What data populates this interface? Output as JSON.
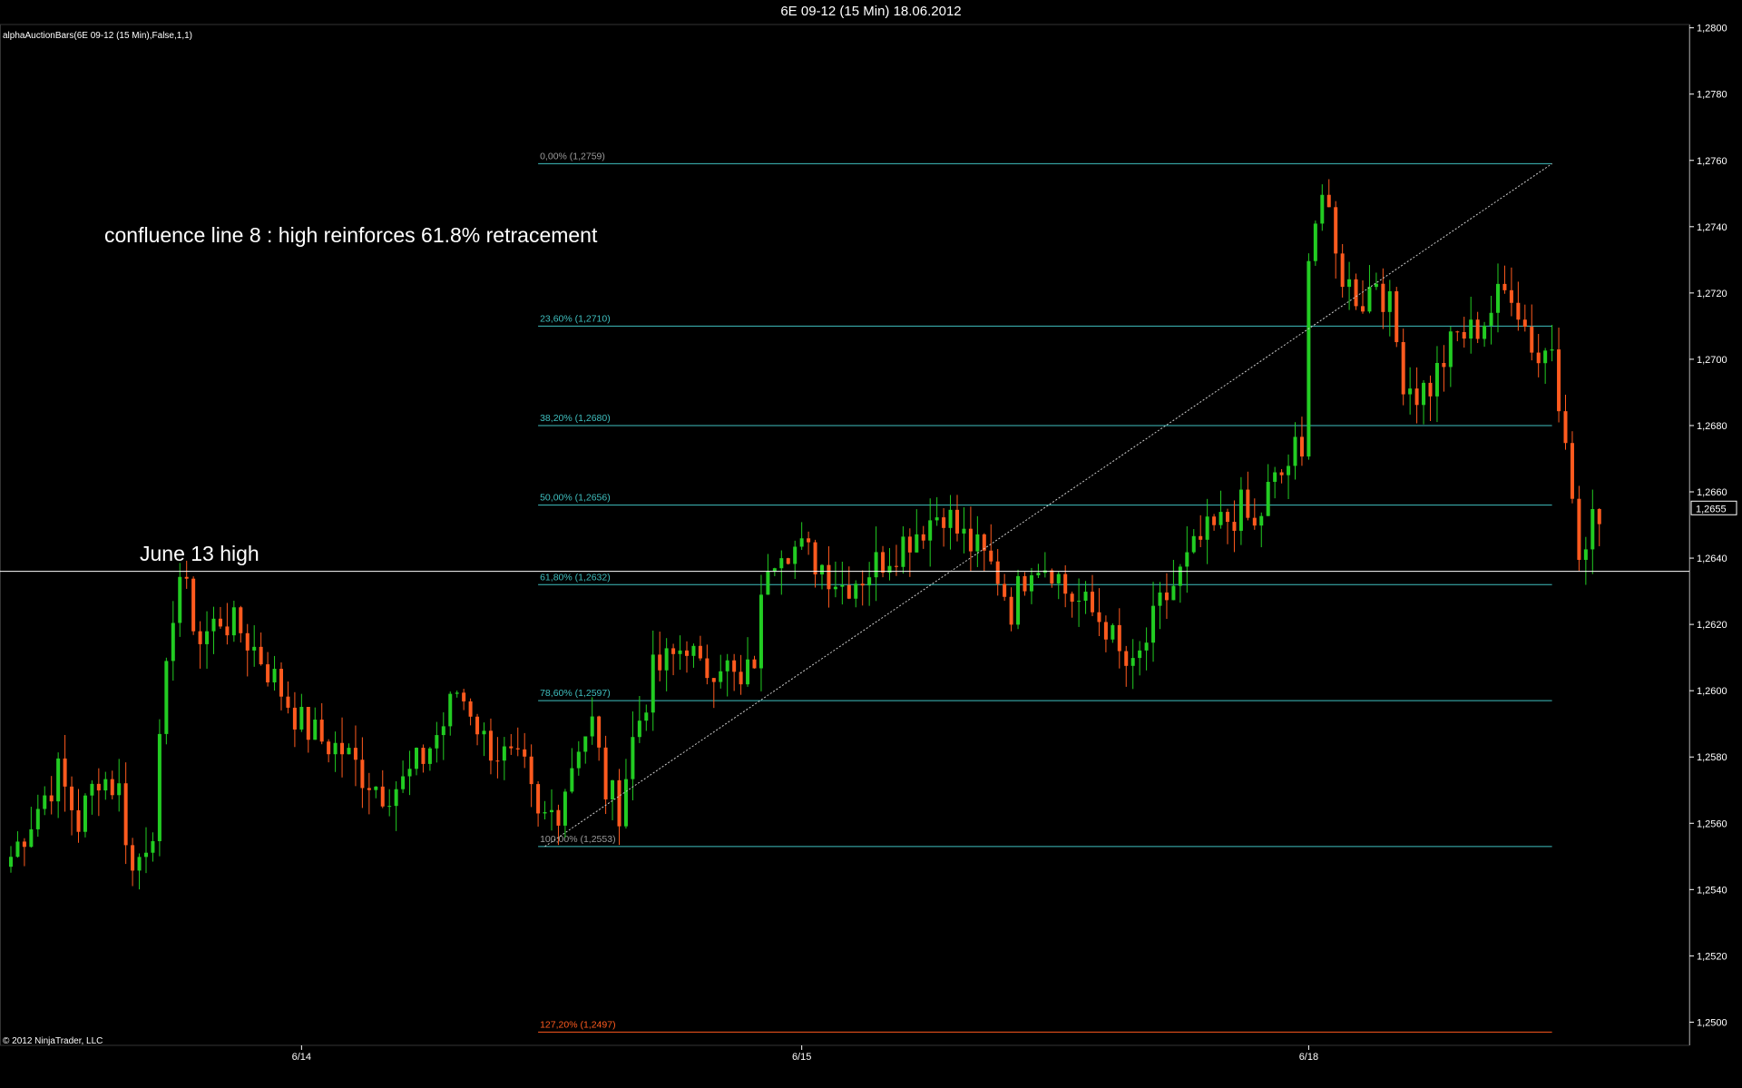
{
  "window": {
    "title": "6E 09-12 (15 Min)  18.06.2012",
    "indicator_label": "alphaAuctionBars(6E 09-12 (15 Min),False,1,1)",
    "copyright": "© 2012 NinjaTrader, LLC"
  },
  "annotations": {
    "confluence_text": "confluence line 8 : high reinforces 61.8% retracement",
    "june13_text": "June 13 high"
  },
  "colors": {
    "background": "#000000",
    "up_candle": "#22cc22",
    "down_candle": "#ff5a1e",
    "fib_line": "#3fbfbf",
    "fib_extension": "#ff5a1e",
    "axis": "#ffffff"
  },
  "chart_data": {
    "type": "candlestick",
    "instrument": "6E 09-12",
    "timeframe": "15 Min",
    "ylim": [
      1.2493,
      1.2801
    ],
    "y_ticks": [
      "1,2500",
      "1,2520",
      "1,2540",
      "1,2560",
      "1,2580",
      "1,2600",
      "1,2620",
      "1,2640",
      "1,2660",
      "1,2680",
      "1,2700",
      "1,2720",
      "1,2740",
      "1,2760",
      "1,2780",
      "1,2800"
    ],
    "x_ticks": [
      {
        "label": "6/14",
        "bar": 43
      },
      {
        "label": "6/15",
        "bar": 117
      },
      {
        "label": "6/18",
        "bar": 192
      }
    ],
    "current_price": "1,2655",
    "june13_high": 1.2636,
    "fibonacci": {
      "start_bar": 78,
      "end_bar": 228,
      "levels": [
        {
          "label": "0,00% (1,2759)",
          "price": 1.2759,
          "color": "grey"
        },
        {
          "label": "23,60% (1,2710)",
          "price": 1.271,
          "color": "cyan"
        },
        {
          "label": "38,20% (1,2680)",
          "price": 1.268,
          "color": "cyan"
        },
        {
          "label": "50,00% (1,2656)",
          "price": 1.2656,
          "color": "cyan"
        },
        {
          "label": "61,80% (1,2632)",
          "price": 1.2632,
          "color": "cyan"
        },
        {
          "label": "78,60% (1,2597)",
          "price": 1.2597,
          "color": "cyan"
        },
        {
          "label": "100,00% (1,2553)",
          "price": 1.2553,
          "color": "grey"
        },
        {
          "label": "127,20% (1,2497)",
          "price": 1.2497,
          "color": "orange"
        }
      ],
      "trendline": {
        "from": [
          79,
          1.2553
        ],
        "to": [
          228,
          1.2759
        ]
      }
    },
    "close_path": [
      [
        0,
        1.255
      ],
      [
        4,
        1.2565
      ],
      [
        7,
        1.2575
      ],
      [
        10,
        1.256
      ],
      [
        13,
        1.2575
      ],
      [
        16,
        1.257
      ],
      [
        18,
        1.2545
      ],
      [
        21,
        1.256
      ],
      [
        24,
        1.2625
      ],
      [
        25,
        1.2635
      ],
      [
        28,
        1.2615
      ],
      [
        31,
        1.2622
      ],
      [
        34,
        1.2618
      ],
      [
        37,
        1.261
      ],
      [
        40,
        1.26
      ],
      [
        43,
        1.259
      ],
      [
        46,
        1.2585
      ],
      [
        49,
        1.2582
      ],
      [
        52,
        1.2575
      ],
      [
        55,
        1.257
      ],
      [
        58,
        1.2572
      ],
      [
        61,
        1.258
      ],
      [
        64,
        1.259
      ],
      [
        66,
        1.26
      ],
      [
        68,
        1.2595
      ],
      [
        70,
        1.2585
      ],
      [
        73,
        1.258
      ],
      [
        76,
        1.2575
      ],
      [
        78,
        1.256
      ],
      [
        81,
        1.2565
      ],
      [
        84,
        1.2585
      ],
      [
        86,
        1.259
      ],
      [
        88,
        1.257
      ],
      [
        90,
        1.2565
      ],
      [
        92,
        1.2585
      ],
      [
        95,
        1.2605
      ],
      [
        98,
        1.261
      ],
      [
        100,
        1.2615
      ],
      [
        102,
        1.2605
      ],
      [
        105,
        1.261
      ],
      [
        108,
        1.26
      ],
      [
        110,
        1.261
      ],
      [
        112,
        1.264
      ],
      [
        114,
        1.2645
      ],
      [
        117,
        1.2642
      ],
      [
        120,
        1.2638
      ],
      [
        123,
        1.2632
      ],
      [
        126,
        1.2635
      ],
      [
        129,
        1.264
      ],
      [
        132,
        1.2645
      ],
      [
        135,
        1.265
      ],
      [
        138,
        1.2655
      ],
      [
        140,
        1.2648
      ],
      [
        143,
        1.2642
      ],
      [
        146,
        1.2635
      ],
      [
        148,
        1.2625
      ],
      [
        151,
        1.264
      ],
      [
        154,
        1.2638
      ],
      [
        156,
        1.263
      ],
      [
        159,
        1.2625
      ],
      [
        162,
        1.262
      ],
      [
        164,
        1.261
      ],
      [
        166,
        1.2605
      ],
      [
        168,
        1.2615
      ],
      [
        170,
        1.2625
      ],
      [
        173,
        1.2635
      ],
      [
        176,
        1.2645
      ],
      [
        179,
        1.265
      ],
      [
        182,
        1.2655
      ],
      [
        184,
        1.2648
      ],
      [
        186,
        1.266
      ],
      [
        188,
        1.2665
      ],
      [
        190,
        1.2672
      ],
      [
        191,
        1.2668
      ],
      [
        192,
        1.2735
      ],
      [
        194,
        1.275
      ],
      [
        196,
        1.273
      ],
      [
        198,
        1.2722
      ],
      [
        200,
        1.2718
      ],
      [
        202,
        1.2725
      ],
      [
        204,
        1.2715
      ],
      [
        206,
        1.2695
      ],
      [
        208,
        1.269
      ],
      [
        210,
        1.2692
      ],
      [
        212,
        1.27
      ],
      [
        214,
        1.2707
      ],
      [
        216,
        1.2708
      ],
      [
        218,
        1.2712
      ],
      [
        220,
        1.2718
      ],
      [
        222,
        1.2722
      ],
      [
        224,
        1.271
      ],
      [
        226,
        1.27
      ],
      [
        228,
        1.2705
      ],
      [
        229,
        1.269
      ],
      [
        230,
        1.268
      ],
      [
        231,
        1.2655
      ],
      [
        232,
        1.264
      ],
      [
        233,
        1.2642
      ],
      [
        234,
        1.265
      ],
      [
        235,
        1.2655
      ]
    ]
  }
}
